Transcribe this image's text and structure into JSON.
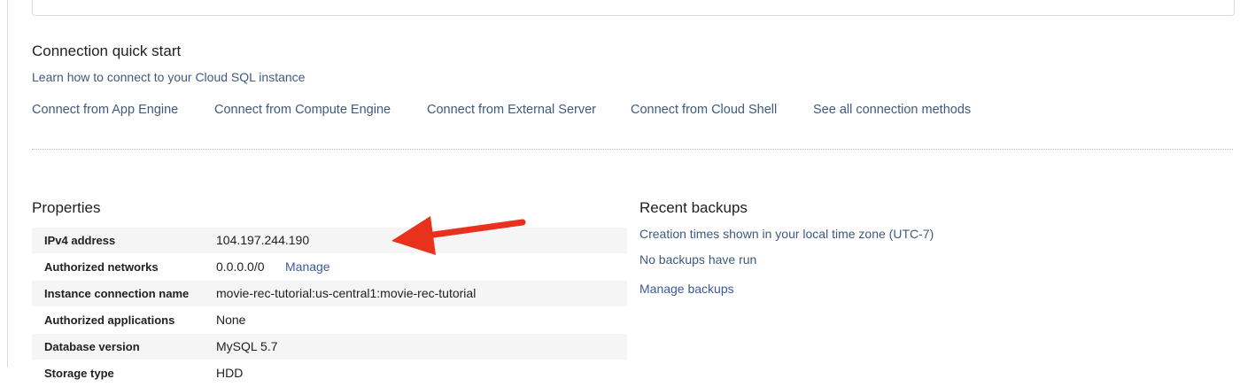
{
  "quick_start": {
    "title": "Connection quick start",
    "subtitle": "Learn how to connect to your Cloud SQL instance",
    "links": [
      "Connect from App Engine",
      "Connect from Compute Engine",
      "Connect from External Server",
      "Connect from Cloud Shell",
      "See all connection methods"
    ]
  },
  "properties": {
    "title": "Properties",
    "rows": [
      {
        "label": "IPv4 address",
        "value": "104.197.244.190"
      },
      {
        "label": "Authorized networks",
        "value": "0.0.0.0/0",
        "link": "Manage"
      },
      {
        "label": "Instance connection name",
        "value": "movie-rec-tutorial:us-central1:movie-rec-tutorial"
      },
      {
        "label": "Authorized applications",
        "value": "None"
      },
      {
        "label": "Database version",
        "value": "MySQL 5.7"
      },
      {
        "label": "Storage type",
        "value": "HDD"
      }
    ]
  },
  "backups": {
    "title": "Recent backups",
    "timezone_note": "Creation times shown in your local time zone (UTC-7)",
    "empty_text": "No backups have run",
    "manage_link": "Manage backups"
  },
  "colors": {
    "link": "#3b5998",
    "annotation_arrow": "#e8321e"
  },
  "icons": [
    "annotation-arrow-icon"
  ]
}
